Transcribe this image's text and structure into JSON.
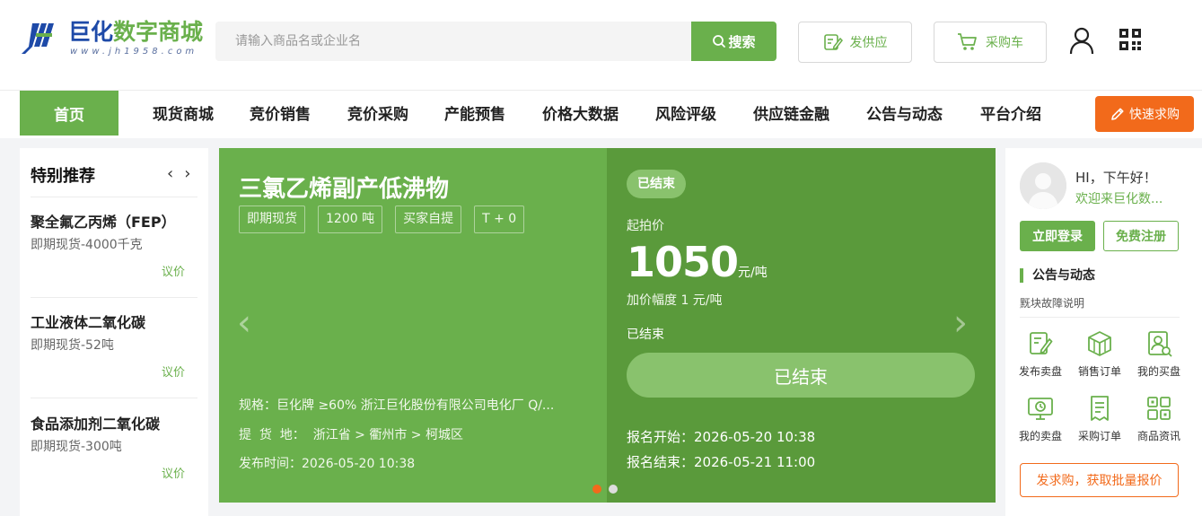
{
  "colors": {
    "brand_green": "#6ab04c",
    "banner_dark": "#5a9a3b",
    "accent_orange": "#f26a1b",
    "logo_blue": "#1e4aa8"
  },
  "header": {
    "logo_name_a": "巨化",
    "logo_name_b": "数字商城",
    "logo_url": "www.jh1958.com",
    "search_placeholder": "请输入商品名或企业名",
    "search_button": "搜索",
    "supply_button": "发供应",
    "cart_button": "采购车"
  },
  "nav": {
    "home": "首页",
    "items": [
      "现货商城",
      "竞价销售",
      "竞价采购",
      "产能预售",
      "价格大数据",
      "风险评级",
      "供应链金融",
      "公告与动态",
      "平台介绍"
    ],
    "quick_buy": "快速求购"
  },
  "recommend": {
    "title": "特别推荐",
    "prev": "‹",
    "next": "›",
    "items": [
      {
        "name": "聚全氟乙丙烯（FEP）",
        "spec": "即期现货-4000千克",
        "price": "议价"
      },
      {
        "name": "工业液体二氧化碳",
        "spec": "即期现货-52吨",
        "price": "议价"
      },
      {
        "name": "食品添加剂二氧化碳",
        "spec": "即期现货-300吨",
        "price": "议价"
      }
    ]
  },
  "banner": {
    "title": "三氯乙烯副产低沸物",
    "tags": [
      "即期现货",
      "1200 吨",
      "买家自提",
      "T + 0"
    ],
    "spec": "规格：巨化牌 ≥60% 浙江巨化股份有限公司电化厂 Q/...",
    "location": "提  货  地：  浙江省 > 衢州市 > 柯城区",
    "publish_time": "发布时间：2026-05-20 10:38",
    "status": "已结束",
    "start_price_label": "起拍价",
    "price": "1050",
    "price_unit": "元/吨",
    "step": "加价幅度  1 元/吨",
    "end_text": "已结束",
    "end_button": "已结束",
    "signup_start": "报名开始：2026-05-20 10:38",
    "signup_end": "报名结束：2026-05-21 11:00",
    "arrow_left": "‹",
    "arrow_right": "›",
    "slides": 2,
    "active_slide": 0
  },
  "user_panel": {
    "greeting": "HI，下午好！",
    "welcome": "欢迎来巨化数...",
    "login": "立即登录",
    "register": "免费注册",
    "notice_title": "公告与动态",
    "notice_item": "黖块故障说明",
    "shortcuts": [
      {
        "label": "发布卖盘",
        "icon": "edit-note-icon"
      },
      {
        "label": "销售订单",
        "icon": "cube-icon"
      },
      {
        "label": "我的买盘",
        "icon": "user-doc-icon"
      },
      {
        "label": "我的卖盘",
        "icon": "monitor-icon"
      },
      {
        "label": "采购订单",
        "icon": "list-doc-icon"
      },
      {
        "label": "商品资讯",
        "icon": "grid-icon"
      }
    ],
    "request_button": "发求购，获取批量报价"
  }
}
